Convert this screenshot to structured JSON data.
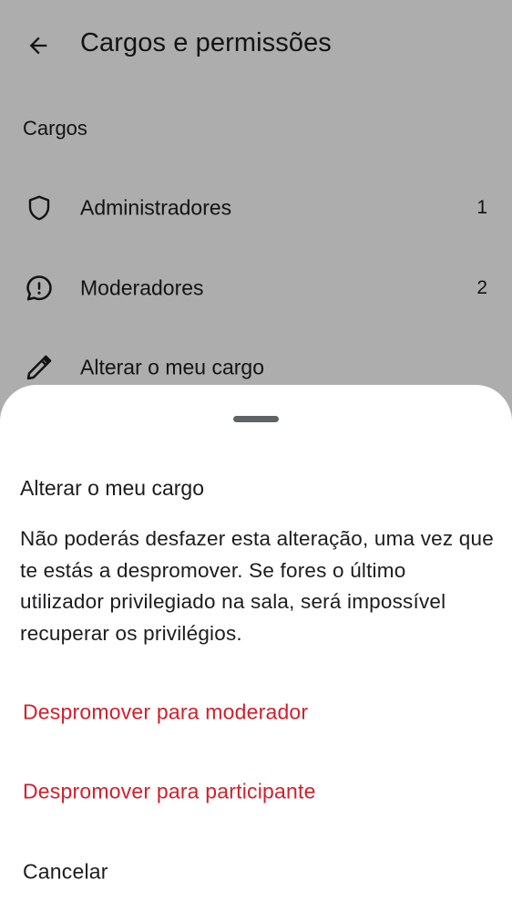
{
  "header": {
    "title": "Cargos e permissões",
    "back_icon": "arrow-back-icon"
  },
  "section": {
    "title": "Cargos"
  },
  "roles": [
    {
      "label": "Administradores",
      "count": "1",
      "icon": "shield-icon"
    },
    {
      "label": "Moderadores",
      "count": "2",
      "icon": "chat-alert-icon"
    },
    {
      "label": "Alterar o meu cargo",
      "count": "",
      "icon": "pencil-icon"
    }
  ],
  "sheet": {
    "title": "Alterar o meu cargo",
    "description": "Não poderás desfazer esta alteração, uma vez que te estás a despromover. Se fores o último utilizador privilegiado na sala, será impossível recuperar os privilégios.",
    "actions": {
      "demote_moderator": "Despromover para moderador",
      "demote_participant": "Despromover para participante",
      "cancel": "Cancelar"
    }
  },
  "colors": {
    "destructive": "#d0212c",
    "text": "#1c1c1e",
    "scrim": "rgba(0,0,0,0.32)"
  }
}
